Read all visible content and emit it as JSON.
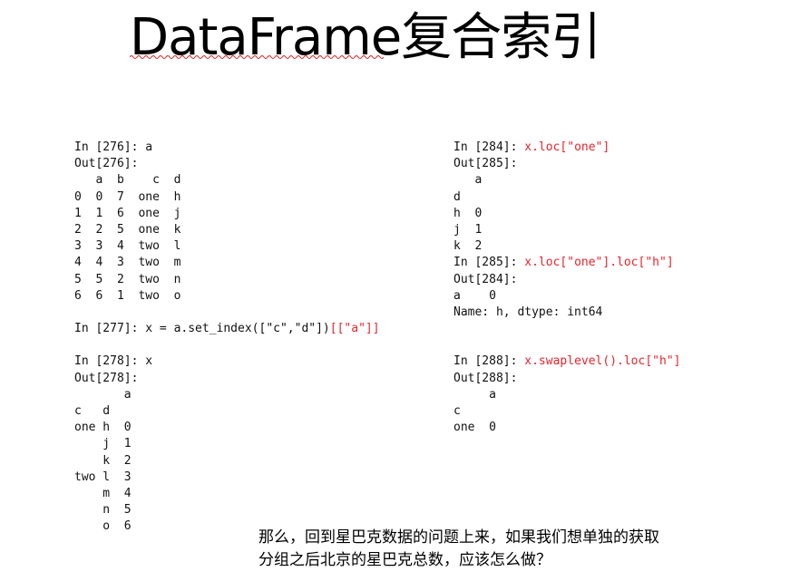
{
  "slide": {
    "title": "DataFrame复合索引"
  },
  "left_code": [
    {
      "text": "In [276]: a"
    },
    {
      "text": "Out[276]:"
    },
    {
      "text": "   a  b    c  d"
    },
    {
      "text": "0  0  7  one  h"
    },
    {
      "text": "1  1  6  one  j"
    },
    {
      "text": "2  2  5  one  k"
    },
    {
      "text": "3  3  4  two  l"
    },
    {
      "text": "4  4  3  two  m"
    },
    {
      "text": "5  5  2  two  n"
    },
    {
      "text": "6  6  1  two  o"
    },
    {
      "text": ""
    },
    {
      "text": "In [277]: x = a.set_index([\"c\",\"d\"])",
      "red": "[[\"a\"]]"
    },
    {
      "text": ""
    },
    {
      "text": "In [278]: x"
    },
    {
      "text": "Out[278]:"
    },
    {
      "text": "       a"
    },
    {
      "text": "c   d"
    },
    {
      "text": "one h  0"
    },
    {
      "text": "    j  1"
    },
    {
      "text": "    k  2"
    },
    {
      "text": "two l  3"
    },
    {
      "text": "    m  4"
    },
    {
      "text": "    n  5"
    },
    {
      "text": "    o  6"
    }
  ],
  "right_code": [
    {
      "text": "In [284]: ",
      "red": "x.loc[\"one\"]"
    },
    {
      "text": "Out[285]:"
    },
    {
      "text": "   a"
    },
    {
      "text": "d"
    },
    {
      "text": "h  0"
    },
    {
      "text": "j  1"
    },
    {
      "text": "k  2"
    },
    {
      "text": "In [285]: ",
      "red": "x.loc[\"one\"].loc[\"h\"]"
    },
    {
      "text": "Out[284]:"
    },
    {
      "text": "a    0"
    },
    {
      "text": "Name: h, dtype: int64"
    },
    {
      "text": ""
    },
    {
      "text": ""
    },
    {
      "text": "In [288]: ",
      "red": "x.swaplevel().loc[\"h\"]"
    },
    {
      "text": "Out[288]:"
    },
    {
      "text": "     a"
    },
    {
      "text": "c"
    },
    {
      "text": "one  0"
    }
  ],
  "caption": {
    "line1": "那么，回到星巴克数据的问题上来，如果我们想单独的获取",
    "line2": "分组之后北京的星巴克总数，应该怎么做？"
  }
}
